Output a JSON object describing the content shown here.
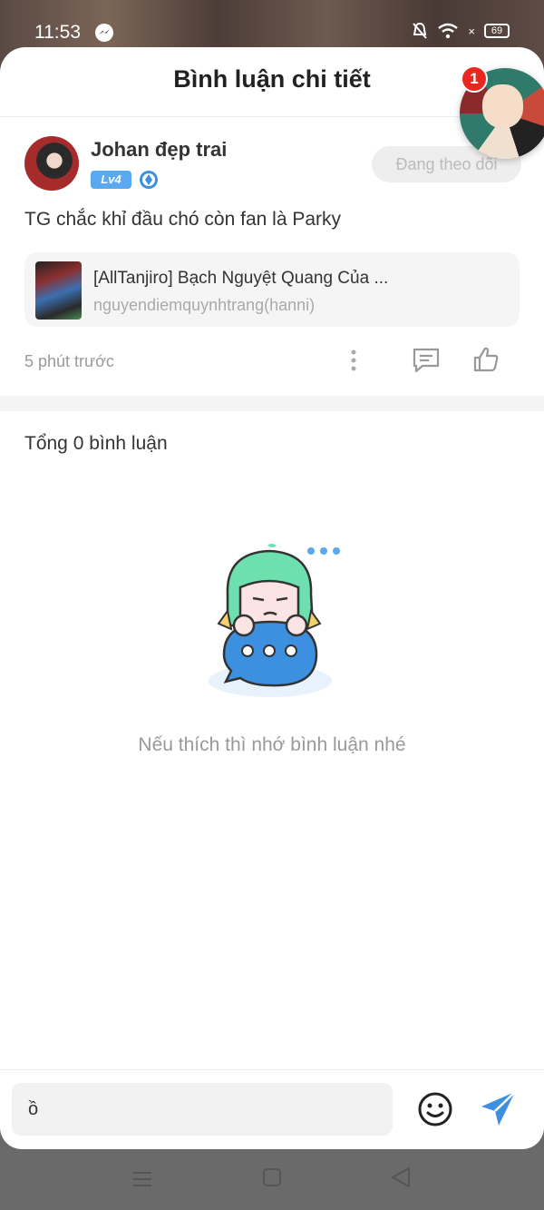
{
  "status_bar": {
    "time": "11:53",
    "battery": "69"
  },
  "header": {
    "title": "Bình luận chi tiết"
  },
  "post": {
    "author": "Johan đẹp trai",
    "level_badge": "Lv4",
    "follow_button": "Đang theo dõi",
    "content": "TG chắc khỉ đầu chó còn fan là Parky",
    "story": {
      "title": "[AllTanjiro] Bạch Nguyệt Quang Của ...",
      "author": "nguyendiemquynhtrang(hanni)"
    },
    "timestamp": "5 phút trước"
  },
  "comments": {
    "total": "Tổng 0 bình luận",
    "empty_message": "Nếu thích thì nhớ bình luận nhé"
  },
  "composer": {
    "value": "ồ"
  },
  "chat_head": {
    "badge": "1"
  },
  "colors": {
    "accent": "#3d8fe0",
    "badge_red": "#e8281f",
    "level_blue": "#5aa8f0"
  }
}
